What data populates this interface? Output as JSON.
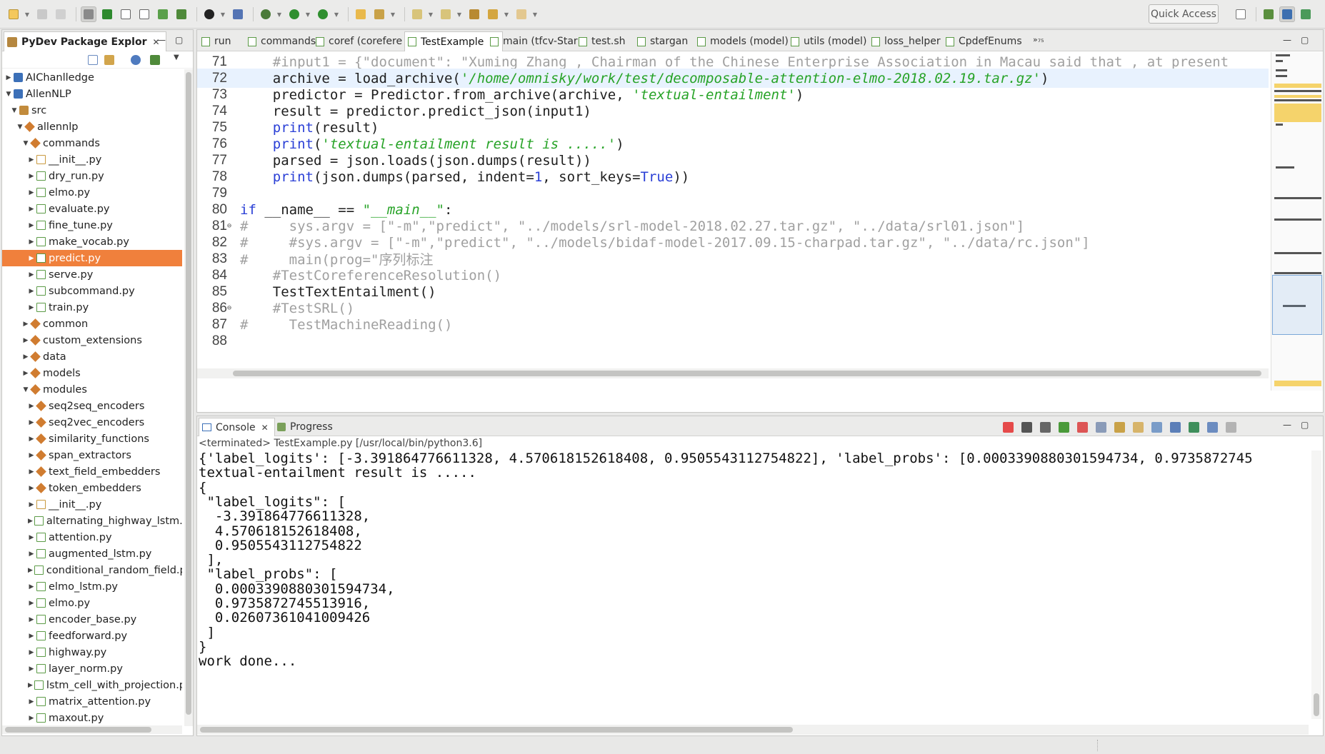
{
  "toolbar": {
    "quick_access": "Quick Access",
    "icons": [
      "new-icon",
      "save-icon",
      "save-all-icon",
      "toggle-icon",
      "outline-icon",
      "new-file-icon",
      "console-icon",
      "search-icon",
      "bug-icon",
      "run-icon",
      "external-tools-icon",
      "open-icon",
      "edit-icon",
      "next-annotation-icon",
      "prev-annotation-icon",
      "back-icon",
      "forward-icon"
    ]
  },
  "package_explorer": {
    "title": "PyDev Package Explor",
    "close": "✕",
    "min": "—",
    "max": "▢",
    "items": [
      {
        "label": "AIChanlledge",
        "depth": 0,
        "kind": "proj",
        "expanded": false
      },
      {
        "label": "AllenNLP",
        "depth": 0,
        "kind": "proj",
        "expanded": true
      },
      {
        "label": "src",
        "depth": 1,
        "kind": "src",
        "expanded": true
      },
      {
        "label": "allennlp",
        "depth": 2,
        "kind": "pkg",
        "expanded": true
      },
      {
        "label": "commands",
        "depth": 3,
        "kind": "pkg",
        "expanded": true
      },
      {
        "label": "__init__.py",
        "depth": 4,
        "kind": "init",
        "expanded": false
      },
      {
        "label": "dry_run.py",
        "depth": 4,
        "kind": "file",
        "expanded": false
      },
      {
        "label": "elmo.py",
        "depth": 4,
        "kind": "file",
        "expanded": false
      },
      {
        "label": "evaluate.py",
        "depth": 4,
        "kind": "file",
        "expanded": false
      },
      {
        "label": "fine_tune.py",
        "depth": 4,
        "kind": "file",
        "expanded": false
      },
      {
        "label": "make_vocab.py",
        "depth": 4,
        "kind": "file",
        "expanded": false
      },
      {
        "label": "predict.py",
        "depth": 4,
        "kind": "file",
        "expanded": false,
        "selected": true
      },
      {
        "label": "serve.py",
        "depth": 4,
        "kind": "file",
        "expanded": false
      },
      {
        "label": "subcommand.py",
        "depth": 4,
        "kind": "file",
        "expanded": false
      },
      {
        "label": "train.py",
        "depth": 4,
        "kind": "file",
        "expanded": false
      },
      {
        "label": "common",
        "depth": 3,
        "kind": "pkg",
        "expanded": false
      },
      {
        "label": "custom_extensions",
        "depth": 3,
        "kind": "pkg",
        "expanded": false
      },
      {
        "label": "data",
        "depth": 3,
        "kind": "pkg",
        "expanded": false
      },
      {
        "label": "models",
        "depth": 3,
        "kind": "pkg",
        "expanded": false
      },
      {
        "label": "modules",
        "depth": 3,
        "kind": "pkg",
        "expanded": true
      },
      {
        "label": "seq2seq_encoders",
        "depth": 4,
        "kind": "pkg",
        "expanded": false
      },
      {
        "label": "seq2vec_encoders",
        "depth": 4,
        "kind": "pkg",
        "expanded": false
      },
      {
        "label": "similarity_functions",
        "depth": 4,
        "kind": "pkg",
        "expanded": false
      },
      {
        "label": "span_extractors",
        "depth": 4,
        "kind": "pkg",
        "expanded": false
      },
      {
        "label": "text_field_embedders",
        "depth": 4,
        "kind": "pkg",
        "expanded": false
      },
      {
        "label": "token_embedders",
        "depth": 4,
        "kind": "pkg",
        "expanded": false
      },
      {
        "label": "__init__.py",
        "depth": 4,
        "kind": "init",
        "expanded": false
      },
      {
        "label": "alternating_highway_lstm.p",
        "depth": 4,
        "kind": "file",
        "expanded": false
      },
      {
        "label": "attention.py",
        "depth": 4,
        "kind": "file",
        "expanded": false
      },
      {
        "label": "augmented_lstm.py",
        "depth": 4,
        "kind": "file",
        "expanded": false
      },
      {
        "label": "conditional_random_field.p",
        "depth": 4,
        "kind": "file",
        "expanded": false
      },
      {
        "label": "elmo_lstm.py",
        "depth": 4,
        "kind": "file",
        "expanded": false
      },
      {
        "label": "elmo.py",
        "depth": 4,
        "kind": "file",
        "expanded": false
      },
      {
        "label": "encoder_base.py",
        "depth": 4,
        "kind": "file",
        "expanded": false
      },
      {
        "label": "feedforward.py",
        "depth": 4,
        "kind": "file",
        "expanded": false
      },
      {
        "label": "highway.py",
        "depth": 4,
        "kind": "file",
        "expanded": false
      },
      {
        "label": "layer_norm.py",
        "depth": 4,
        "kind": "file",
        "expanded": false
      },
      {
        "label": "lstm_cell_with_projection.p",
        "depth": 4,
        "kind": "file",
        "expanded": false
      },
      {
        "label": "matrix_attention.py",
        "depth": 4,
        "kind": "file",
        "expanded": false
      },
      {
        "label": "maxout.py",
        "depth": 4,
        "kind": "file",
        "expanded": false
      }
    ]
  },
  "editor": {
    "tabs": [
      {
        "label": "run",
        "active": false
      },
      {
        "label": "commands",
        "active": false
      },
      {
        "label": "coref (corefere",
        "active": false
      },
      {
        "label": "TestExample",
        "active": true
      },
      {
        "label": "main (tfcv-Star",
        "active": false
      },
      {
        "label": "test.sh",
        "active": false
      },
      {
        "label": "stargan",
        "active": false
      },
      {
        "label": "models (model)",
        "active": false
      },
      {
        "label": "utils (model)",
        "active": false
      },
      {
        "label": "loss_helper",
        "active": false
      },
      {
        "label": "CpdefEnums",
        "active": false
      }
    ],
    "overflow": "»₇₅",
    "min": "—",
    "max": "▢",
    "lines": [
      {
        "n": "71",
        "hl": false,
        "fold": "",
        "segs": [
          [
            "c-cm",
            "    #input1 = {\"document\": \"Xuming Zhang , Chairman of the Chinese Enterprise Association in Macau said that , at present"
          ]
        ]
      },
      {
        "n": "72",
        "hl": true,
        "fold": "",
        "segs": [
          [
            "ct",
            "    archive = load_archive("
          ],
          [
            "c-str",
            "'/home/omnisky/work/test/decomposable-attention-elmo-2018.02.19.tar.gz'"
          ],
          [
            "ct",
            ")"
          ]
        ]
      },
      {
        "n": "73",
        "hl": false,
        "fold": "",
        "segs": [
          [
            "ct",
            "    predictor = Predictor.from_archive(archive, "
          ],
          [
            "c-str",
            "'textual-entailment'"
          ],
          [
            "ct",
            ")"
          ]
        ]
      },
      {
        "n": "74",
        "hl": false,
        "fold": "",
        "segs": [
          [
            "ct",
            "    result = predictor.predict_json(input1)"
          ]
        ]
      },
      {
        "n": "75",
        "hl": false,
        "fold": "",
        "segs": [
          [
            "c-kw",
            "    print"
          ],
          [
            "ct",
            "(result)"
          ]
        ]
      },
      {
        "n": "76",
        "hl": false,
        "fold": "",
        "segs": [
          [
            "c-kw",
            "    print"
          ],
          [
            "ct",
            "("
          ],
          [
            "c-str",
            "'textual-entailment result is .....'"
          ],
          [
            "ct",
            ")"
          ]
        ]
      },
      {
        "n": "77",
        "hl": false,
        "fold": "",
        "segs": [
          [
            "ct",
            "    parsed = json.loads(json.dumps(result))"
          ]
        ]
      },
      {
        "n": "78",
        "hl": false,
        "fold": "",
        "segs": [
          [
            "c-kw",
            "    print"
          ],
          [
            "ct",
            "(json.dumps(parsed, indent="
          ],
          [
            "c-num",
            "1"
          ],
          [
            "ct",
            ", sort_keys="
          ],
          [
            "c-kw",
            "True"
          ],
          [
            "ct",
            "))"
          ]
        ]
      },
      {
        "n": "79",
        "hl": false,
        "fold": "",
        "segs": [
          [
            "ct",
            ""
          ]
        ]
      },
      {
        "n": "80",
        "hl": false,
        "fold": "",
        "segs": [
          [
            "c-kw",
            "if"
          ],
          [
            "ct",
            " __name__ == "
          ],
          [
            "c-str",
            "\"__main__\""
          ],
          [
            "ct",
            ":"
          ]
        ]
      },
      {
        "n": "81",
        "hl": false,
        "fold": "⊖",
        "segs": [
          [
            "c-cm",
            "#     sys.argv = [\"-m\",\"predict\", \"../models/srl-model-2018.02.27.tar.gz\", \"../data/srl01.json\"]"
          ]
        ]
      },
      {
        "n": "82",
        "hl": false,
        "fold": "",
        "segs": [
          [
            "c-cm",
            "#     #sys.argv = [\"-m\",\"predict\", \"../models/bidaf-model-2017.09.15-charpad.tar.gz\", \"../data/rc.json\"]"
          ]
        ]
      },
      {
        "n": "83",
        "hl": false,
        "fold": "",
        "segs": [
          [
            "c-cm",
            "#     main(prog=\"序列标注"
          ]
        ]
      },
      {
        "n": "84",
        "hl": false,
        "fold": "",
        "segs": [
          [
            "c-cm",
            "    #TestCoreferenceResolution()"
          ]
        ]
      },
      {
        "n": "85",
        "hl": false,
        "fold": "",
        "segs": [
          [
            "ct",
            "    TestTextEntailment()"
          ]
        ]
      },
      {
        "n": "86",
        "hl": false,
        "fold": "⊖",
        "segs": [
          [
            "c-cm",
            "    #TestSRL()"
          ]
        ]
      },
      {
        "n": "87",
        "hl": false,
        "fold": "",
        "segs": [
          [
            "c-cm",
            "#     TestMachineReading()"
          ]
        ]
      },
      {
        "n": "88",
        "hl": false,
        "fold": "",
        "segs": [
          [
            "ct",
            ""
          ]
        ]
      }
    ]
  },
  "console": {
    "tab_label": "Console",
    "progress_label": "Progress",
    "close": "✕",
    "min": "—",
    "max": "▢",
    "status": "<terminated> TestExample.py [/usr/local/bin/python3.6]",
    "output": [
      "{'label_logits': [-3.391864776611328, 4.570618152618408, 0.9505543112754822], 'label_probs': [0.0003390880301594734, 0.9735872745",
      "textual-entailment result is .....",
      "{",
      " \"label_logits\": [",
      "  -3.391864776611328,",
      "  4.570618152618408,",
      "  0.9505543112754822",
      " ],",
      " \"label_probs\": [",
      "  0.0003390880301594734,",
      "  0.9735872745513916,",
      "  0.02607361041009426",
      " ]",
      "}",
      "work done..."
    ]
  },
  "colors": {
    "selection": "#f0803c",
    "current_line": "#e8f2fe",
    "keyword": "#2a3fd6",
    "string": "#27a327",
    "comment": "#a0a0a0"
  }
}
